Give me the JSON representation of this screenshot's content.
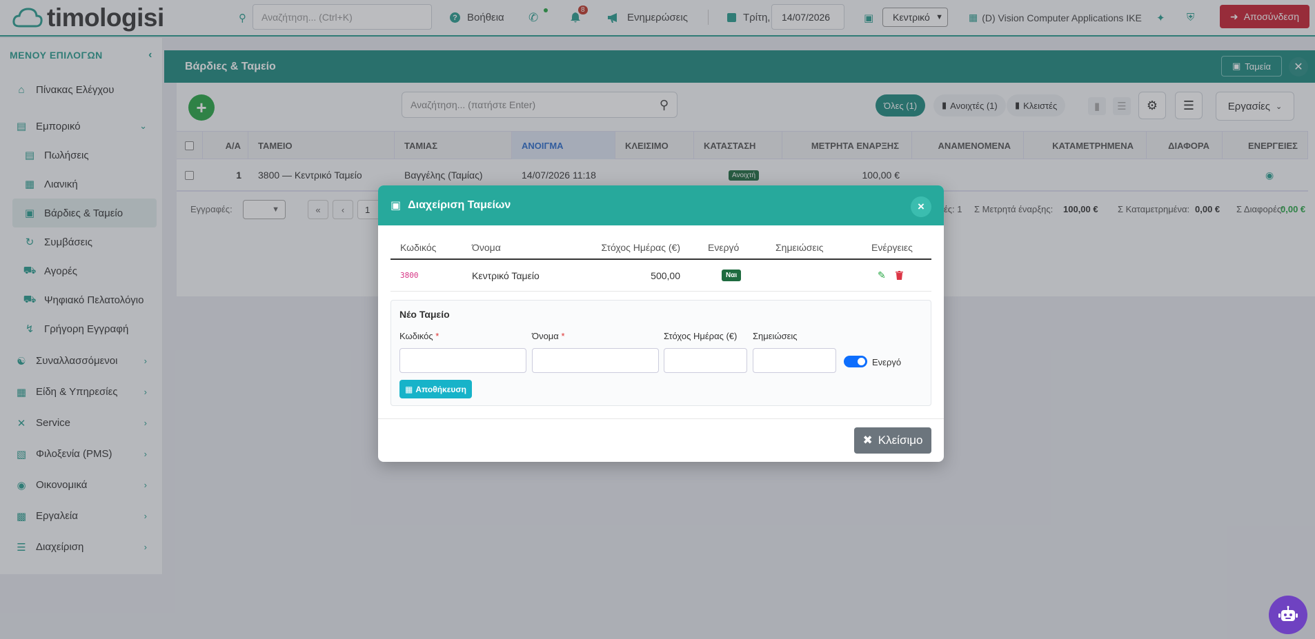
{
  "topbar": {
    "logo_text": "timologisi",
    "search_placeholder": "Αναζήτηση... (Ctrl+K)",
    "help": "Βοήθεια",
    "notifications_count": "8",
    "updates": "Ενημερώσεις",
    "day": "Τρίτη,",
    "date": "14/07/2026",
    "branch": "Κεντρικό",
    "company": "(D) Vision Computer Applications IKE",
    "logout": "Αποσύνδεση"
  },
  "sidebar": {
    "title": "ΜΕΝΟΥ ΕΠΙΛΟΓΩΝ",
    "items": [
      {
        "label": "Πίνακας Ελέγχου",
        "icon": "home-icon"
      },
      {
        "label": "Εμπορικό",
        "icon": "layers-icon"
      },
      {
        "label": "Πωλήσεις",
        "icon": "file-icon"
      },
      {
        "label": "Λιανική",
        "icon": "receipt-icon"
      },
      {
        "label": "Βάρδιες & Ταμείο",
        "icon": "cash-register-icon"
      },
      {
        "label": "Συμβάσεις",
        "icon": "sync-icon"
      },
      {
        "label": "Αγορές",
        "icon": "cart-icon"
      },
      {
        "label": "Ψηφιακό Πελατολόγιο",
        "icon": "car-icon"
      },
      {
        "label": "Γρήγορη Εγγραφή",
        "icon": "bolt-icon"
      },
      {
        "label": "Συναλλασσόμενοι",
        "icon": "handshake-icon"
      },
      {
        "label": "Είδη & Υπηρεσίες",
        "icon": "boxes-icon"
      },
      {
        "label": "Service",
        "icon": "tools-icon"
      },
      {
        "label": "Φιλοξενία (PMS)",
        "icon": "hotel-icon"
      },
      {
        "label": "Οικονομικά",
        "icon": "coins-icon"
      },
      {
        "label": "Εργαλεία",
        "icon": "toolbox-icon"
      },
      {
        "label": "Διαχείριση",
        "icon": "sliders-icon"
      }
    ]
  },
  "page": {
    "title": "Βάρδιες & Ταμείο",
    "tameia_btn": "Ταμεία",
    "search_placeholder": "Αναζήτηση... (πατήστε Enter)",
    "filters": {
      "all": "Όλες (1)",
      "open": "Ανοιχτές (1)",
      "closed": "Κλειστές"
    },
    "actions": "Εργασίες",
    "columns": [
      "Α/Α",
      "ΤΑΜΕΙΟ",
      "ΤΑΜΙΑΣ",
      "ΑΝΟΙΓΜΑ",
      "ΚΛΕΙΣΙΜΟ",
      "ΚΑΤΑΣΤΑΣΗ",
      "ΜΕΤΡΗΤΑ ΕΝΑΡΞΗΣ",
      "ΑΝΑΜΕΝΟΜΕΝΑ",
      "ΚΑΤΑΜΕΤΡΗΜΕΝΑ",
      "ΔΙΑΦΟΡΑ",
      "ΕΝΕΡΓΕΙΕΣ"
    ],
    "row": {
      "aa": "1",
      "tameio": "3800 — Κεντρικό Ταμείο",
      "tamias": "Βαγγέλης (Ταμίας)",
      "opening": "14/07/2026 11:18",
      "status": "Ανοιχτή",
      "start_cash": "100,00 €"
    },
    "pager": {
      "records_label": "Εγγραφές:",
      "page": "1"
    },
    "summary": {
      "count_tail": "ές: 1",
      "start_label": "Σ Μετρητά έναρξης:",
      "start_val": "100,00 €",
      "counted_label": "Σ Καταμετρημένα:",
      "counted_val": "0,00 €",
      "diff_label": "Σ Διαφορές:",
      "diff_val": "0,00 €"
    }
  },
  "modal": {
    "title": "Διαχείριση Ταμείων",
    "columns": {
      "code": "Κωδικός",
      "name": "Όνομα",
      "target": "Στόχος Ημέρας (€)",
      "active": "Ενεργό",
      "notes": "Σημειώσεις",
      "actions": "Ενέργειες"
    },
    "row": {
      "code": "3800",
      "name": "Κεντρικό Ταμείο",
      "target": "500,00",
      "active": "Ναι"
    },
    "new_title": "Νέο Ταμείο",
    "form": {
      "code": "Κωδικός",
      "name": "Όνομα",
      "target": "Στόχος Ημέρας (€)",
      "notes": "Σημειώσεις",
      "active": "Ενεργό",
      "required_mark": "*"
    },
    "save": "Αποθήκευση",
    "close": "Κλείσιμο"
  }
}
